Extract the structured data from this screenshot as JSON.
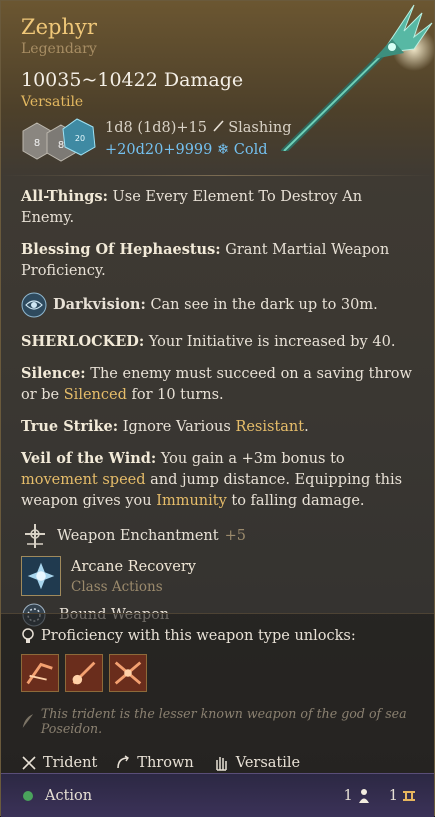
{
  "item": {
    "name": "Zephyr",
    "rarity": "Legendary",
    "damage": "10035~10422 Damage",
    "property_tag": "Versatile",
    "dice": {
      "left_value": "8",
      "right_value": "8",
      "top_value": "20"
    },
    "damage_line1": "1d8 (1d8)+15",
    "damage_type1": "Slashing",
    "damage_line2": "+20d20+9999",
    "damage_type2": "Cold"
  },
  "properties": [
    {
      "name": "All-Things:",
      "text": "Use Every Element To Destroy An Enemy."
    },
    {
      "name": "Blessing Of Hephaestus:",
      "text": "Grant Martial Weapon Proficiency."
    },
    {
      "name": "Darkvision:",
      "text": "Can see in the dark up to 30m."
    },
    {
      "name": "SHERLOCKED:",
      "text": "Your Initiative is increased by 40."
    },
    {
      "name": "Silence:",
      "text_a": "The enemy must succeed on a saving throw or be",
      "text_hl": "Silenced",
      "text_b": "for 10 turns."
    },
    {
      "name": "True Strike:",
      "text_a": "Ignore Various",
      "text_hl": "Resistant",
      "text_b": "."
    },
    {
      "name": "Veil of the Wind:",
      "text_a": "You gain a +3m bonus to",
      "text_hl1": "movement speed",
      "text_b": "and jump distance. Equipping this weapon gives you",
      "text_hl2": "Immunity",
      "text_c": "to falling damage."
    }
  ],
  "actions": {
    "enchantment_label": "Weapon Enchantment",
    "enchantment_value": "+5",
    "arcane_title": "Arcane Recovery",
    "arcane_sub": "Class Actions",
    "bound_label": "Bound Weapon"
  },
  "proficiency": {
    "title": "Proficiency with this weapon type unlocks:",
    "icons": [
      "lacerate-icon",
      "pommel-strike-icon",
      "flourish-icon"
    ]
  },
  "flavor": "This trident is the lesser known weapon of the god of sea Poseidon.",
  "tags": [
    "Trident",
    "Thrown",
    "Versatile"
  ],
  "footer": {
    "label": "Action",
    "action_count": "1",
    "bonus_count": "1"
  },
  "colors": {
    "title": "#f0c879",
    "cold": "#74c0ee",
    "highlight": "#e6bd6a",
    "action_dot": "#4aa35c"
  }
}
